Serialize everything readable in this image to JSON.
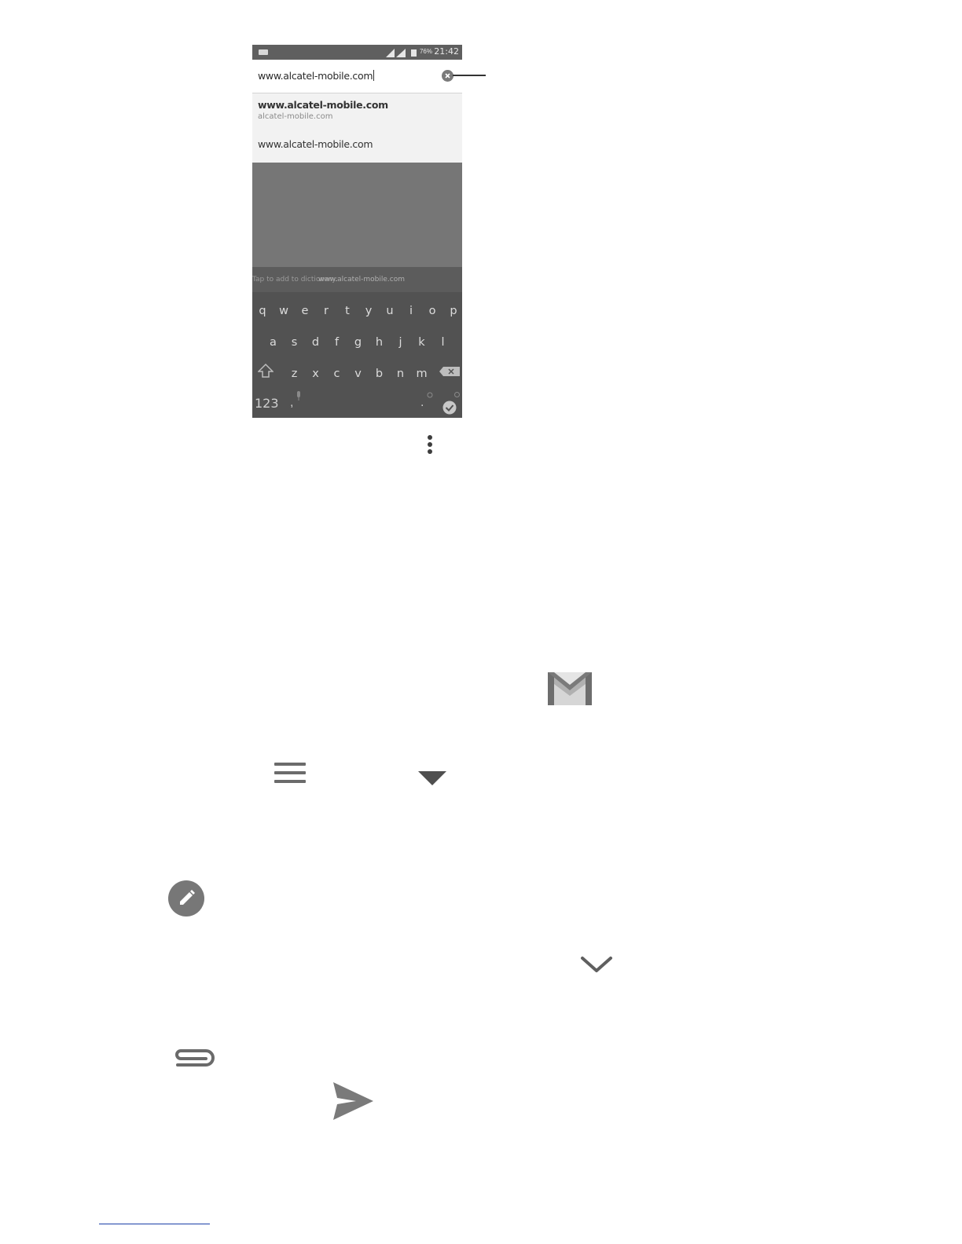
{
  "status_bar": {
    "battery_percent": "76%",
    "time": "21:42"
  },
  "browser": {
    "url_value": "www.alcatel-mobile.com",
    "suggestions": [
      {
        "title": "www.alcatel-mobile.com",
        "subtitle": "alcatel-mobile.com"
      },
      {
        "title": "www.alcatel-mobile.com",
        "subtitle": ""
      }
    ]
  },
  "keyboard": {
    "suggestion_prefix": "Tap to add to dictionary:",
    "suggestion_word": "www.alcatel-mobile.com",
    "row1": [
      "q",
      "w",
      "e",
      "r",
      "t",
      "y",
      "u",
      "i",
      "o",
      "p"
    ],
    "row2": [
      "a",
      "s",
      "d",
      "f",
      "g",
      "h",
      "j",
      "k",
      "l"
    ],
    "row3": [
      "z",
      "x",
      "c",
      "v",
      "b",
      "n",
      "m"
    ],
    "bottom": {
      "numbers": "123",
      "comma": ",",
      "period": "."
    }
  },
  "icons": [
    "more-vert-icon",
    "gmail-icon",
    "hamburger-menu-icon",
    "dropdown-triangle-icon",
    "compose-pencil-icon",
    "chevron-down-icon",
    "attach-clip-icon",
    "send-icon"
  ],
  "colors": {
    "phone_bg": "#767676",
    "keyboard_bg": "#525252",
    "icon_gray": "#6b6b6b",
    "link_rule": "#1a3ea8"
  }
}
